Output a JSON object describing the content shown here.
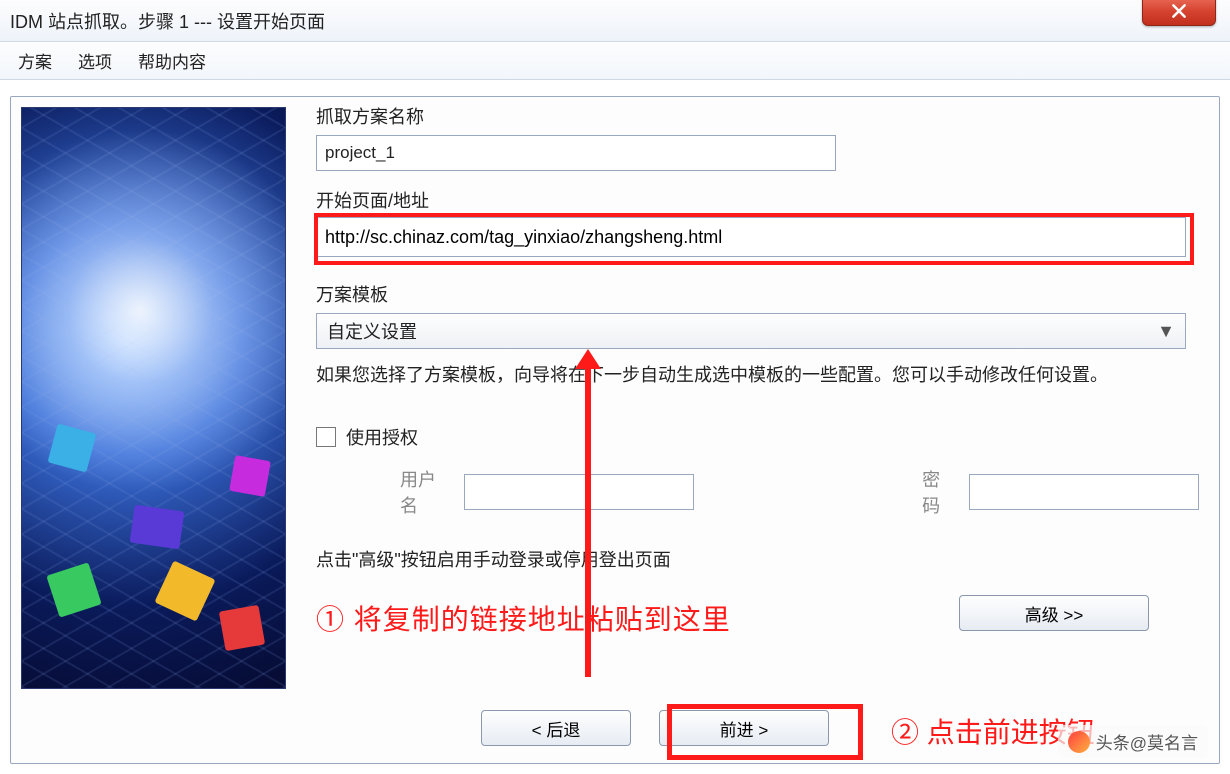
{
  "window": {
    "title": "IDM 站点抓取。步骤 1 --- 设置开始页面"
  },
  "menu": {
    "scheme": "方案",
    "options": "选项",
    "help": "帮助内容"
  },
  "form": {
    "project_name_label": "抓取方案名称",
    "project_name_value": "project_1",
    "start_url_label": "开始页面/地址",
    "start_url_value": "http://sc.chinaz.com/tag_yinxiao/zhangsheng.html",
    "template_label": "万案模板",
    "template_value": "自定义设置",
    "template_help": "如果您选择了方案模板，向导将在下一步自动生成选中模板的一些配置。您可以手动修改任何设置。",
    "use_auth_label": "使用授权",
    "username_label": "用户名",
    "password_label": "密码",
    "advanced_hint": "点击\"高级\"按钮启用手动登录或停用登出页面",
    "advanced_button": "高级 >>"
  },
  "nav": {
    "back": "< 后退",
    "forward": "前进 >"
  },
  "annotations": {
    "step1": "① 将复制的链接地址粘贴到这里",
    "step2": "② 点击前进按钮"
  },
  "watermark": "头条@莫名言"
}
